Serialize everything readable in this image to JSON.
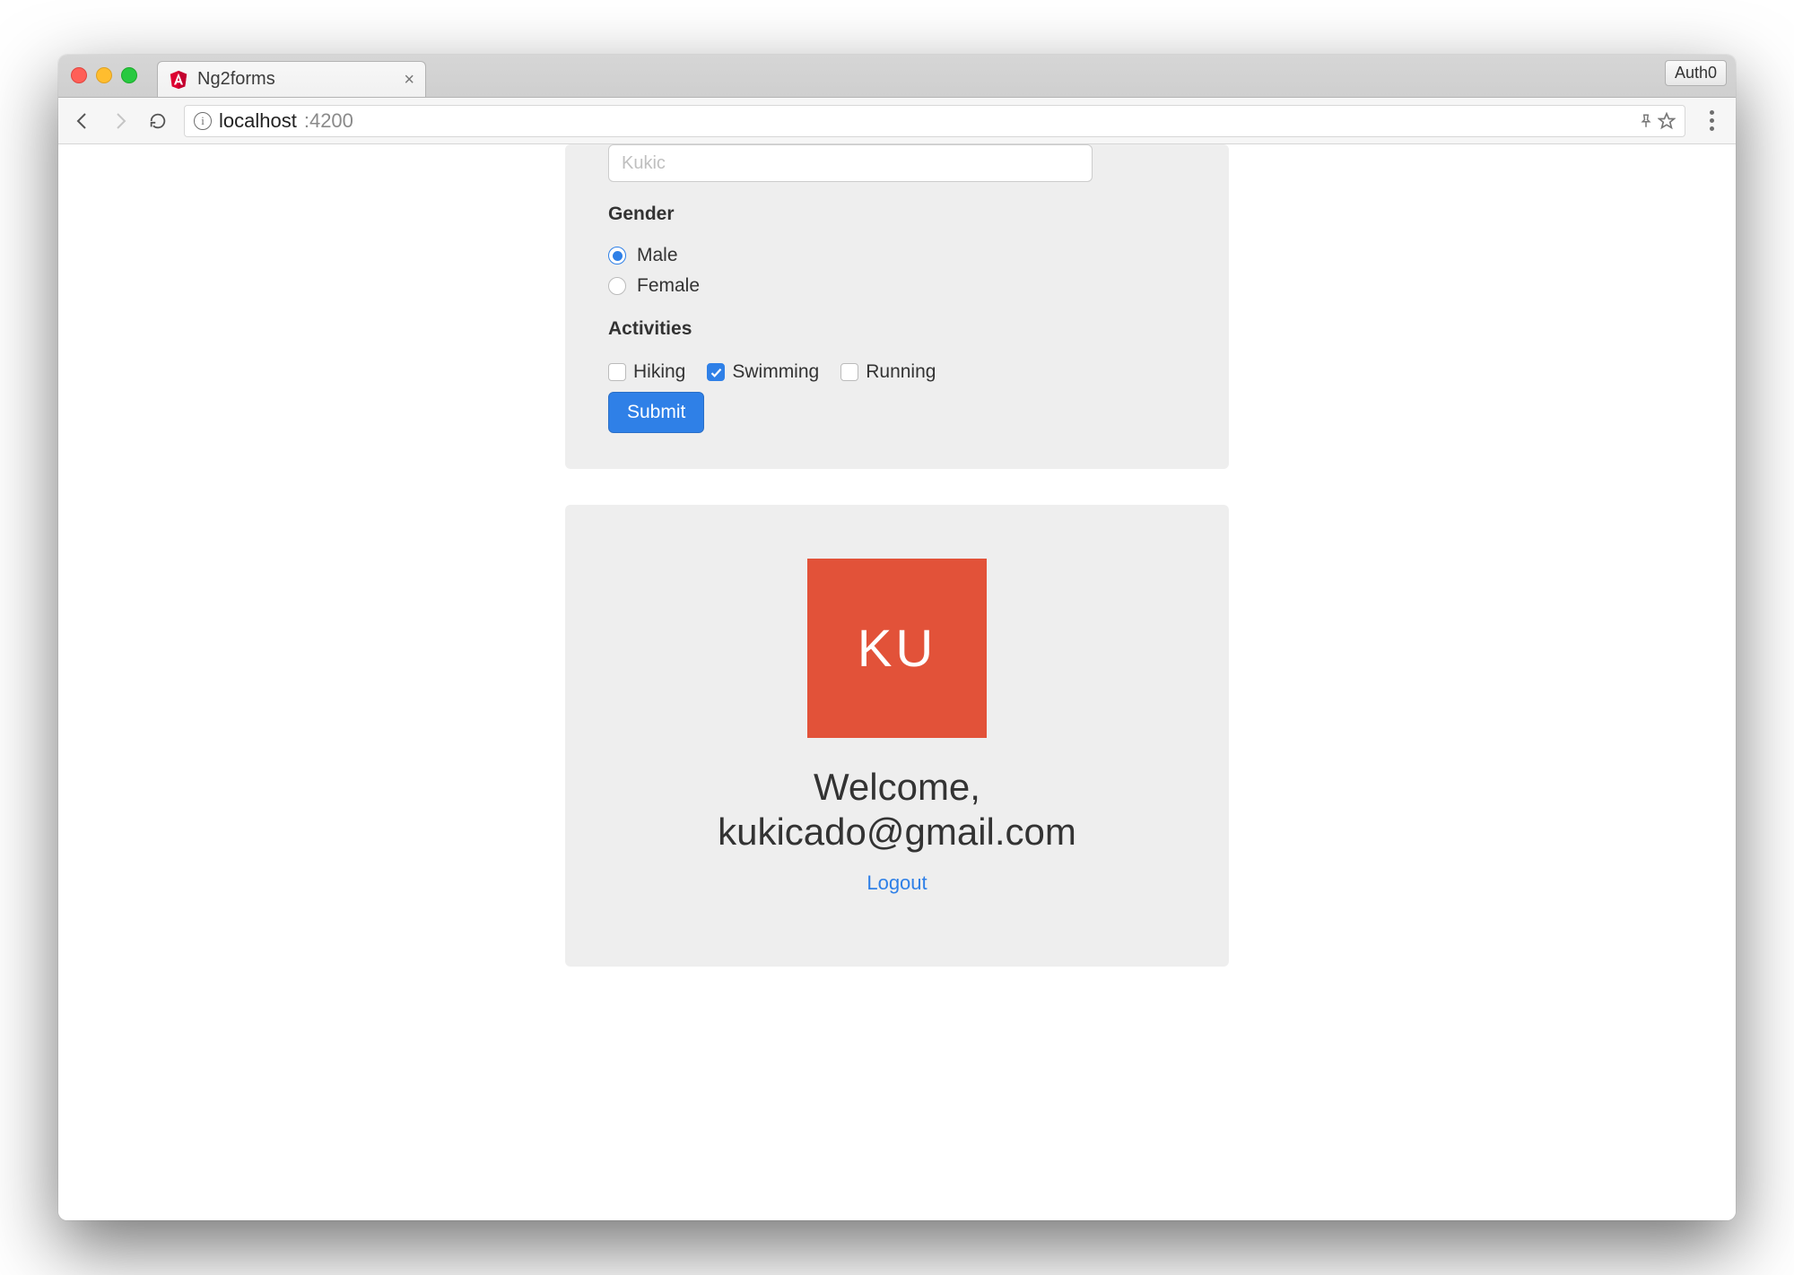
{
  "browser": {
    "tab_title": "Ng2forms",
    "profile_label": "Auth0",
    "url_host": "localhost",
    "url_rest": ":4200"
  },
  "form": {
    "name_value": "Kukic",
    "gender_label": "Gender",
    "gender_options": {
      "male": "Male",
      "female": "Female"
    },
    "gender_selected": "male",
    "activities_label": "Activities",
    "activities": {
      "hiking": {
        "label": "Hiking",
        "checked": false
      },
      "swimming": {
        "label": "Swimming",
        "checked": true
      },
      "running": {
        "label": "Running",
        "checked": false
      }
    },
    "submit_label": "Submit"
  },
  "profile": {
    "avatar_initials": "KU",
    "avatar_color": "#e25239",
    "welcome_prefix": "Welcome,",
    "email": "kukicado@gmail.com",
    "logout_label": "Logout"
  }
}
